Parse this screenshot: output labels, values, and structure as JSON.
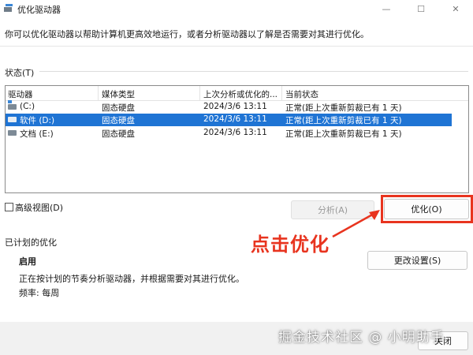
{
  "window": {
    "title": "优化驱动器",
    "controls": {
      "minimize": "—",
      "maximize": "☐",
      "close": "✕"
    }
  },
  "description": "你可以优化驱动器以帮助计算机更高效地运行，或者分析驱动器以了解是否需要对其进行优化。",
  "status": {
    "label": "状态(T)",
    "columns": [
      "驱动器",
      "媒体类型",
      "上次分析或优化的...",
      "当前状态"
    ],
    "drives": [
      {
        "icon": "system-drive-icon",
        "name": "(C:)",
        "media": "固态硬盘",
        "last": "2024/3/6 13:11",
        "state": "正常(距上次重新剪裁已有 1 天)",
        "selected": false
      },
      {
        "icon": "drive-icon",
        "name": "软件 (D:)",
        "media": "固态硬盘",
        "last": "2024/3/6 13:11",
        "state": "正常(距上次重新剪裁已有 1 天)",
        "selected": true
      },
      {
        "icon": "drive-icon",
        "name": "文档 (E:)",
        "media": "固态硬盘",
        "last": "2024/3/6 13:11",
        "state": "正常(距上次重新剪裁已有 1 天)",
        "selected": false
      }
    ]
  },
  "advanced_view_label": "高级视图(D)",
  "buttons": {
    "analyze": "分析(A)",
    "optimize": "优化(O)",
    "change_settings": "更改设置(S)",
    "close": "关闭"
  },
  "annotation": "点击优化",
  "scheduled": {
    "title": "已计划的优化",
    "enabled": "启用",
    "description": "正在按计划的节奏分析驱动器，并根据需要对其进行优化。",
    "frequency": "频率: 每周"
  },
  "watermark": "掘金技术社区 @ 小明助手",
  "colors": {
    "selection": "#1f74d4",
    "annotation": "#e8341f"
  }
}
